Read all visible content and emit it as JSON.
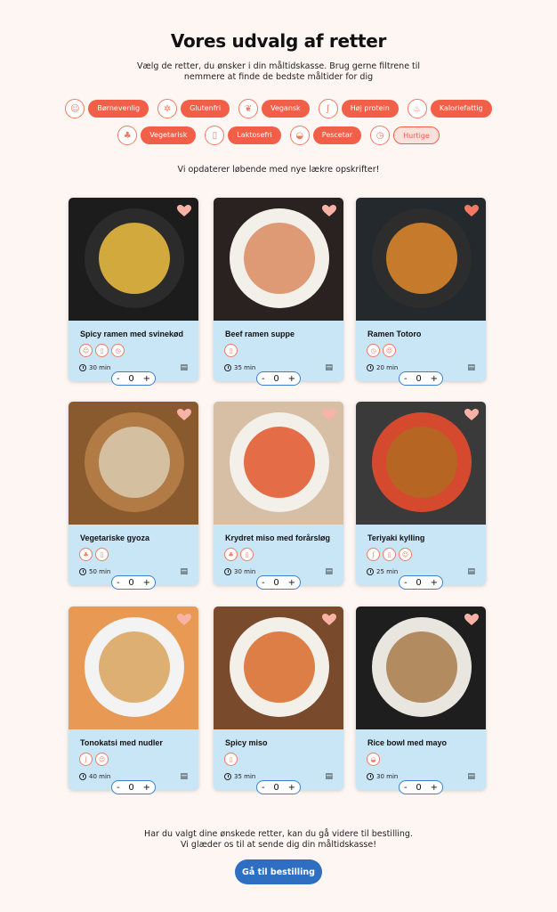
{
  "header": {
    "title": "Vores udvalg af retter",
    "subtitle": "Vælg de retter, du ønsker i din måltidskasse. Brug gerne filtrene til nemmere at finde de bedste måltider for dig"
  },
  "filters": [
    {
      "label": "Børnevenlig",
      "icon": "smile-icon",
      "glyph": "☺"
    },
    {
      "label": "Glutenfri",
      "icon": "wheat-icon",
      "glyph": "✲"
    },
    {
      "label": "Vegansk",
      "icon": "leaf-icon",
      "glyph": "❦"
    },
    {
      "label": "Høj protein",
      "icon": "muscle-icon",
      "glyph": "ʃ"
    },
    {
      "label": "Kaloriefattig",
      "icon": "flame-icon",
      "glyph": "♨"
    },
    {
      "label": "Vegetarisk",
      "icon": "vegetable-icon",
      "glyph": "♣"
    },
    {
      "label": "Laktosefri",
      "icon": "milk-icon",
      "glyph": "▯"
    },
    {
      "label": "Pescetar",
      "icon": "fish-icon",
      "glyph": "◒"
    },
    {
      "label": "Hurtige",
      "icon": "timer-icon",
      "glyph": "◷"
    }
  ],
  "update_note": "Vi opdaterer løbende med nye lækre opskrifter!",
  "dishes": [
    {
      "name": "Spicy ramen med svinekød",
      "time": "30 min",
      "qty": "0",
      "tags": [
        "☺",
        "▯",
        "◷"
      ]
    },
    {
      "name": "Beef ramen suppe",
      "time": "35 min",
      "qty": "0",
      "tags": [
        "▯"
      ]
    },
    {
      "name": "Ramen Totoro",
      "time": "20 min",
      "qty": "0",
      "tags": [
        "◷",
        "☺"
      ]
    },
    {
      "name": "Vegetariske gyoza",
      "time": "50 min",
      "qty": "0",
      "tags": [
        "♣",
        "▯"
      ]
    },
    {
      "name": "Krydret miso med forårsløg",
      "time": "30 min",
      "qty": "0",
      "tags": [
        "♣",
        "▯"
      ]
    },
    {
      "name": "Teriyaki kylling",
      "time": "25 min",
      "qty": "0",
      "tags": [
        "ʃ",
        "▯",
        "☺"
      ]
    },
    {
      "name": "Tonokatsi med nudler",
      "time": "40 min",
      "qty": "0",
      "tags": [
        "ʃ",
        "☺"
      ]
    },
    {
      "name": "Spicy miso",
      "time": "35 min",
      "qty": "0",
      "tags": [
        "▯"
      ]
    },
    {
      "name": "Rice bowl med mayo",
      "time": "30 min",
      "qty": "0",
      "tags": [
        "◒"
      ]
    }
  ],
  "footer": {
    "line1": "Har du valgt dine ønskede retter, kan du gå videre til bestilling.",
    "line2": "Vi glæder os til at sende dig din måltidskasse!",
    "order_button": "Gå til bestilling"
  },
  "stepper": {
    "minus": "-",
    "plus": "+"
  },
  "colors": {
    "accent": "#f25f48",
    "card": "#c9e6f6",
    "button": "#2f6fc2",
    "background": "#fdf6f3"
  }
}
